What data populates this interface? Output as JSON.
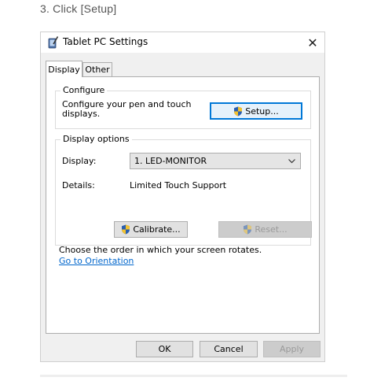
{
  "page": {
    "step_caption": "3. Click [Setup]"
  },
  "dialog": {
    "title": "Tablet PC Settings",
    "close_glyph": "✕",
    "tabs": [
      {
        "label": "Display",
        "selected": true
      },
      {
        "label": "Other",
        "selected": false
      }
    ],
    "configure": {
      "legend": "Configure",
      "description": "Configure your pen and touch displays.",
      "setup_label": "Setup..."
    },
    "display_options": {
      "legend": "Display options",
      "display_label": "Display:",
      "display_value": "1. LED-MONITOR",
      "details_label": "Details:",
      "details_value": "Limited Touch Support",
      "calibrate_label": "Calibrate...",
      "reset_label": "Reset..."
    },
    "orientation": {
      "text": "Choose the order in which your screen rotates.",
      "link": "Go to Orientation"
    },
    "footer": {
      "ok_label": "OK",
      "cancel_label": "Cancel",
      "apply_label": "Apply"
    }
  },
  "icons": {
    "title_icon": "tablet-pen-icon",
    "close_icon": "close-icon",
    "shield_icon": "uac-shield-icon",
    "chevron": "chevron-down-icon"
  },
  "colors": {
    "accent": "#0078d7",
    "link": "#0066cc",
    "dialog_bg": "#f0f0f0",
    "disabled_bg": "#cccccc",
    "disabled_text": "#9a9a9a"
  }
}
